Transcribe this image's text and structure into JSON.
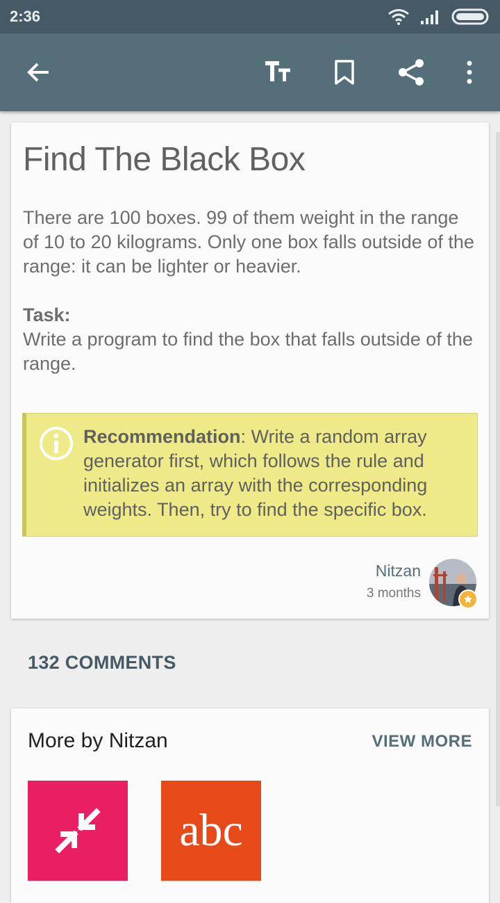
{
  "status_bar": {
    "time": "2:36"
  },
  "toolbar": {
    "back_icon": "arrow-left-icon",
    "text_size_label": "TT",
    "bookmark_icon": "bookmark-icon",
    "share_icon": "share-icon",
    "overflow_icon": "more-vert-icon"
  },
  "post": {
    "title": "Find The Black Box",
    "description": "There are 100 boxes. 99 of them weight in the range of 10 to 20 kilograms. Only one box falls outside of the range: it can be lighter or heavier.",
    "task_label": "Task:",
    "task_text": "Write a program to find the box that falls outside of the range.",
    "recommendation_label": "Recommendation",
    "recommendation_text": ": Write a random array generator first, which follows the rule and initializes an array with the corresponding weights. Then, try to find the specific box.",
    "author_name": "Nitzan",
    "author_time": "3 months"
  },
  "comments": {
    "label": "132 COMMENTS"
  },
  "more_by": {
    "title": "More by Nitzan",
    "view_more_label": "VIEW MORE",
    "tiles": [
      {
        "icon": "compress-arrows-icon",
        "color": "#e91e63"
      },
      {
        "text": "abc",
        "color": "#e64a19"
      }
    ]
  },
  "colors": {
    "appbar": "#546e7a",
    "statusbar": "#455a64",
    "recommendation_bg": "#eeea88"
  }
}
